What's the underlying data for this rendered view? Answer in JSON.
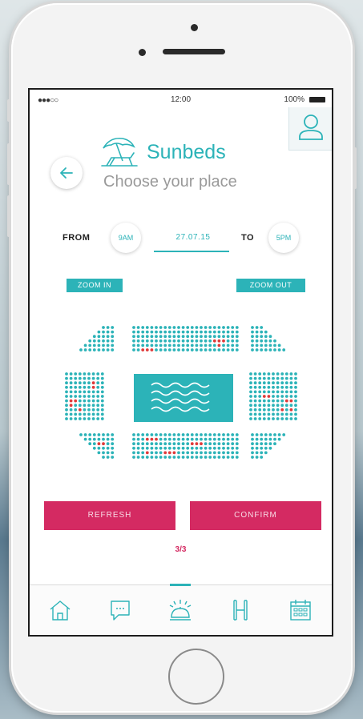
{
  "status_bar": {
    "signal": "●●●○○",
    "time": "12:00",
    "battery": "100%"
  },
  "header": {
    "title": "Sunbeds",
    "subtitle": "Choose your place"
  },
  "time_range": {
    "from_label": "FROM",
    "from_time": "9AM",
    "date": "27.07.15",
    "to_label": "TO",
    "to_time": "5PM"
  },
  "zoom": {
    "zoom_in": "ZOOM IN",
    "zoom_out": "ZOOM OUT"
  },
  "actions": {
    "refresh": "REFRESH",
    "confirm": "CONFIRM"
  },
  "pager": "3/3",
  "tabs": [
    {
      "name": "home-icon"
    },
    {
      "name": "chat-icon"
    },
    {
      "name": "service-bell-icon",
      "active": true
    },
    {
      "name": "hotel-icon"
    },
    {
      "name": "calendar-icon"
    }
  ],
  "colors": {
    "accent": "#2cb3b8",
    "primary": "#d42a62",
    "taken_seat": "#e03a3a"
  }
}
